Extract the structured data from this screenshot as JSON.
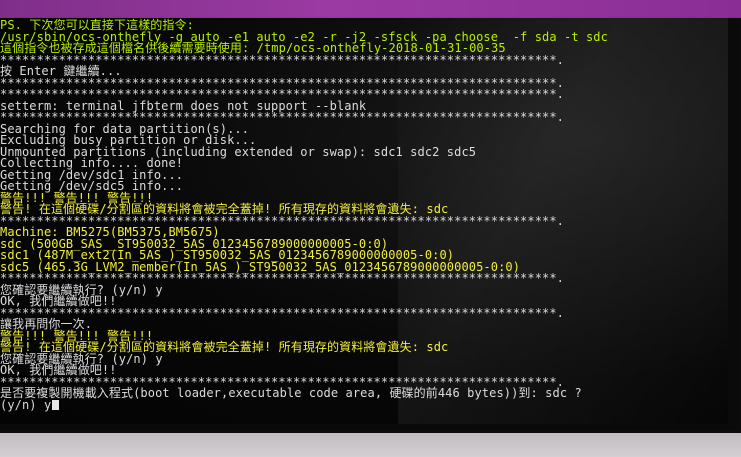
{
  "terminal": {
    "lines": [
      {
        "text": "PS. 下次您可以直接下這樣的指令:",
        "color": "green"
      },
      {
        "text": "/usr/sbin/ocs-onthefly -g auto -e1 auto -e2 -r -j2 -sfsck -pa choose  -f sda -t sdc",
        "color": "green"
      },
      {
        "text": "這個指令也被存成這個檔名供後續需要時使用: /tmp/ocs-onthefly-2018-01-31-00-35",
        "color": "green"
      },
      {
        "text": "****************************************************************************.",
        "color": "white"
      },
      {
        "text": "按 Enter 鍵繼續...",
        "color": "white"
      },
      {
        "text": "****************************************************************************.",
        "color": "white"
      },
      {
        "text": "****************************************************************************.",
        "color": "white"
      },
      {
        "text": "setterm: terminal jfbterm does not support --blank",
        "color": "white"
      },
      {
        "text": "****************************************************************************.",
        "color": "white"
      },
      {
        "text": "Searching for data partition(s)...",
        "color": "white"
      },
      {
        "text": "Excluding busy partition or disk...",
        "color": "white"
      },
      {
        "text": "Unmounted partitions (including extended or swap): sdc1 sdc2 sdc5",
        "color": "white"
      },
      {
        "text": "Collecting info.... done!",
        "color": "white"
      },
      {
        "text": "Getting /dev/sdc1 info...",
        "color": "white"
      },
      {
        "text": "Getting /dev/sdc5 info...",
        "color": "white"
      },
      {
        "text": "警告!!! 警告!!! 警告!!!",
        "color": "yellow"
      },
      {
        "text": "警告! 在這個硬碟/分割區的資料將會被完全蓋掉! 所有現存的資料將會遺失: sdc",
        "color": "yellow"
      },
      {
        "text": "****************************************************************************.",
        "color": "white"
      },
      {
        "text": "Machine: BM5275(BM5375,BM5675)",
        "color": "yellow"
      },
      {
        "text": "sdc (500GB_SAS__ST950032_5AS_0123456789000000005-0:0)",
        "color": "yellow"
      },
      {
        "text": "sdc1 (487M_ext2(In_5AS_)_ST950032_5AS_0123456789000000005-0:0)",
        "color": "yellow"
      },
      {
        "text": "sdc5 (465.3G_LVM2_member(In_5AS_)_ST950032_5AS_0123456789000000005-0:0)",
        "color": "yellow"
      },
      {
        "text": "****************************************************************************.",
        "color": "white"
      },
      {
        "text": "您確認要繼續執行? (y/n) y",
        "color": "white"
      },
      {
        "text": "OK, 我們繼續做吧!!",
        "color": "white"
      },
      {
        "text": "****************************************************************************.",
        "color": "white"
      },
      {
        "text": "讓我再問你一次.",
        "color": "white"
      },
      {
        "text": "警告!!! 警告!!! 警告!!!",
        "color": "yellow"
      },
      {
        "text": "警告! 在這個硬碟/分割區的資料將會被完全蓋掉! 所有現存的資料將會遺失: sdc",
        "color": "yellow"
      },
      {
        "text": "您確認要繼續執行? (y/n) y",
        "color": "white"
      },
      {
        "text": "OK, 我們繼續做吧!!",
        "color": "white"
      },
      {
        "text": "****************************************************************************.",
        "color": "white"
      },
      {
        "text": "是否要複製開機載入程式(boot loader,executable code area, 硬碟的前446 bytes))到: sdc ?",
        "color": "white"
      },
      {
        "text": "(y/n) y",
        "color": "white"
      }
    ]
  },
  "colors": {
    "green": "#b8f000",
    "yellow": "#f2ef3a",
    "white": "#dcdcdc"
  }
}
